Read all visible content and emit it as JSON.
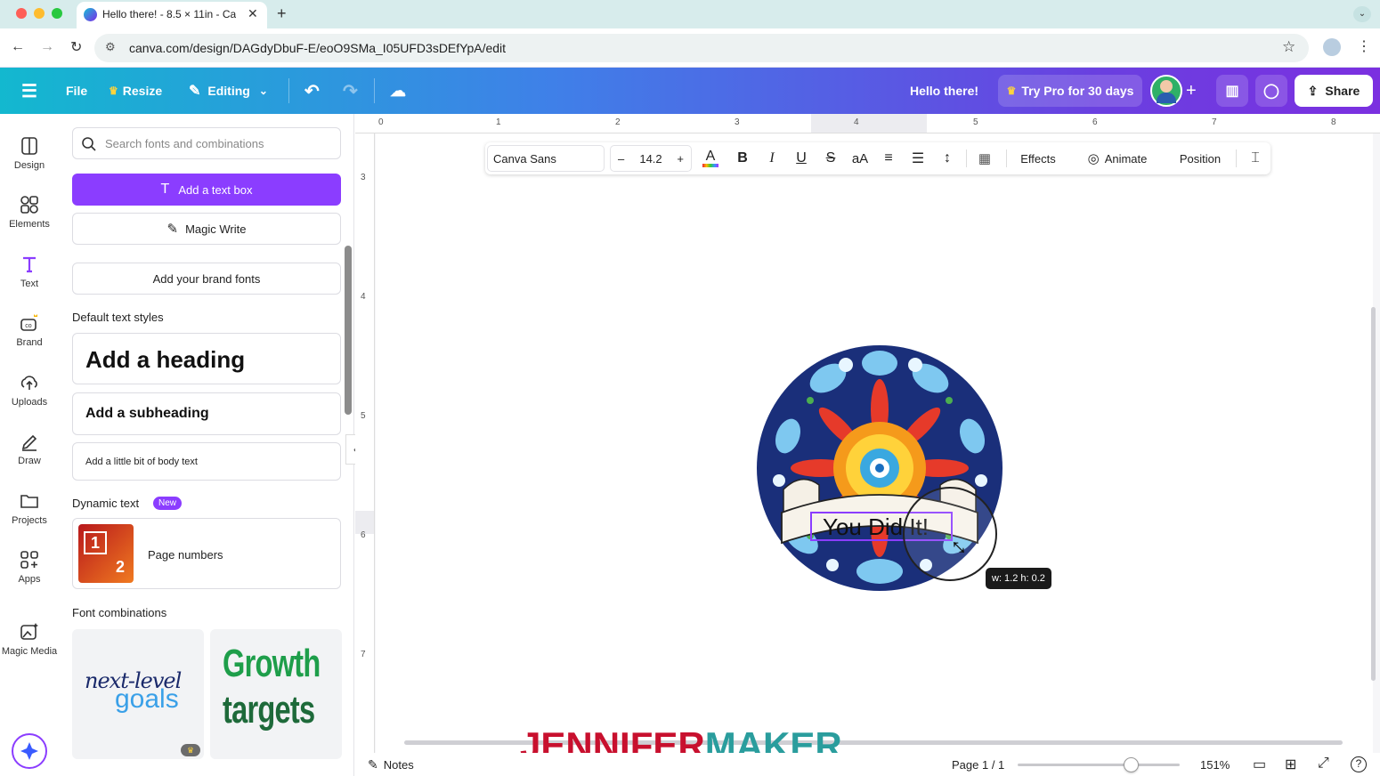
{
  "browser": {
    "tab_title": "Hello there! - 8.5 × 11in - Can",
    "url": "canva.com/design/DAGdyDbuF-E/eoO9SMa_I05UFD3sDEfYpA/edit",
    "new_tab": "+"
  },
  "header": {
    "file": "File",
    "resize": "Resize",
    "editing": "Editing",
    "doc_title": "Hello there!",
    "try_pro": "Try Pro for 30 days",
    "share": "Share"
  },
  "rail": {
    "items": [
      {
        "label": "Design",
        "icon": "design-icon"
      },
      {
        "label": "Elements",
        "icon": "elements-icon"
      },
      {
        "label": "Text",
        "icon": "text-icon"
      },
      {
        "label": "Brand",
        "icon": "brand-icon"
      },
      {
        "label": "Uploads",
        "icon": "uploads-icon"
      },
      {
        "label": "Draw",
        "icon": "draw-icon"
      },
      {
        "label": "Projects",
        "icon": "projects-icon"
      },
      {
        "label": "Apps",
        "icon": "apps-icon"
      },
      {
        "label": "Magic Media",
        "icon": "magic-media-icon"
      }
    ]
  },
  "panel": {
    "search_placeholder": "Search fonts and combinations",
    "add_text_box": "Add a text box",
    "magic_write": "Magic Write",
    "brand_fonts": "Add your brand fonts",
    "default_styles": "Default text styles",
    "heading": "Add a heading",
    "subheading": "Add a subheading",
    "body": "Add a little bit of body text",
    "dynamic_text": "Dynamic text",
    "new_badge": "New",
    "page_numbers": "Page numbers",
    "page_num_1": "1",
    "page_num_2": "2",
    "font_combinations": "Font combinations",
    "combo1_line1": "next-level",
    "combo1_line2": "goals",
    "combo2_line1": "Growth",
    "combo2_line2": "targets"
  },
  "toolbar": {
    "font": "Canva Sans",
    "minus": "–",
    "size": "14.2",
    "plus": "+",
    "bold": "B",
    "italic": "I",
    "underline": "U",
    "strike": "S",
    "case": "aA",
    "effects": "Effects",
    "animate": "Animate",
    "position": "Position"
  },
  "ruler": {
    "top": [
      "0",
      "1",
      "2",
      "3",
      "4",
      "5",
      "6",
      "7",
      "8"
    ],
    "left": [
      "3",
      "4",
      "5",
      "6",
      "7"
    ]
  },
  "canvas": {
    "banner_text": "You Did It!",
    "size_tooltip": "w: 1.2 h: 0.2",
    "watermark_red": "JENNIFER",
    "watermark_teal": "MAKER"
  },
  "bottom": {
    "notes": "Notes",
    "page": "Page 1 / 1",
    "zoom": "151%",
    "zoom_level": 0.7,
    "help": "?"
  },
  "colors": {
    "accent": "#8b3dff",
    "header_start": "#13b8cf",
    "header_end": "#7b30e0",
    "watermark_red": "#c8102e",
    "watermark_teal": "#2a9d9d"
  }
}
